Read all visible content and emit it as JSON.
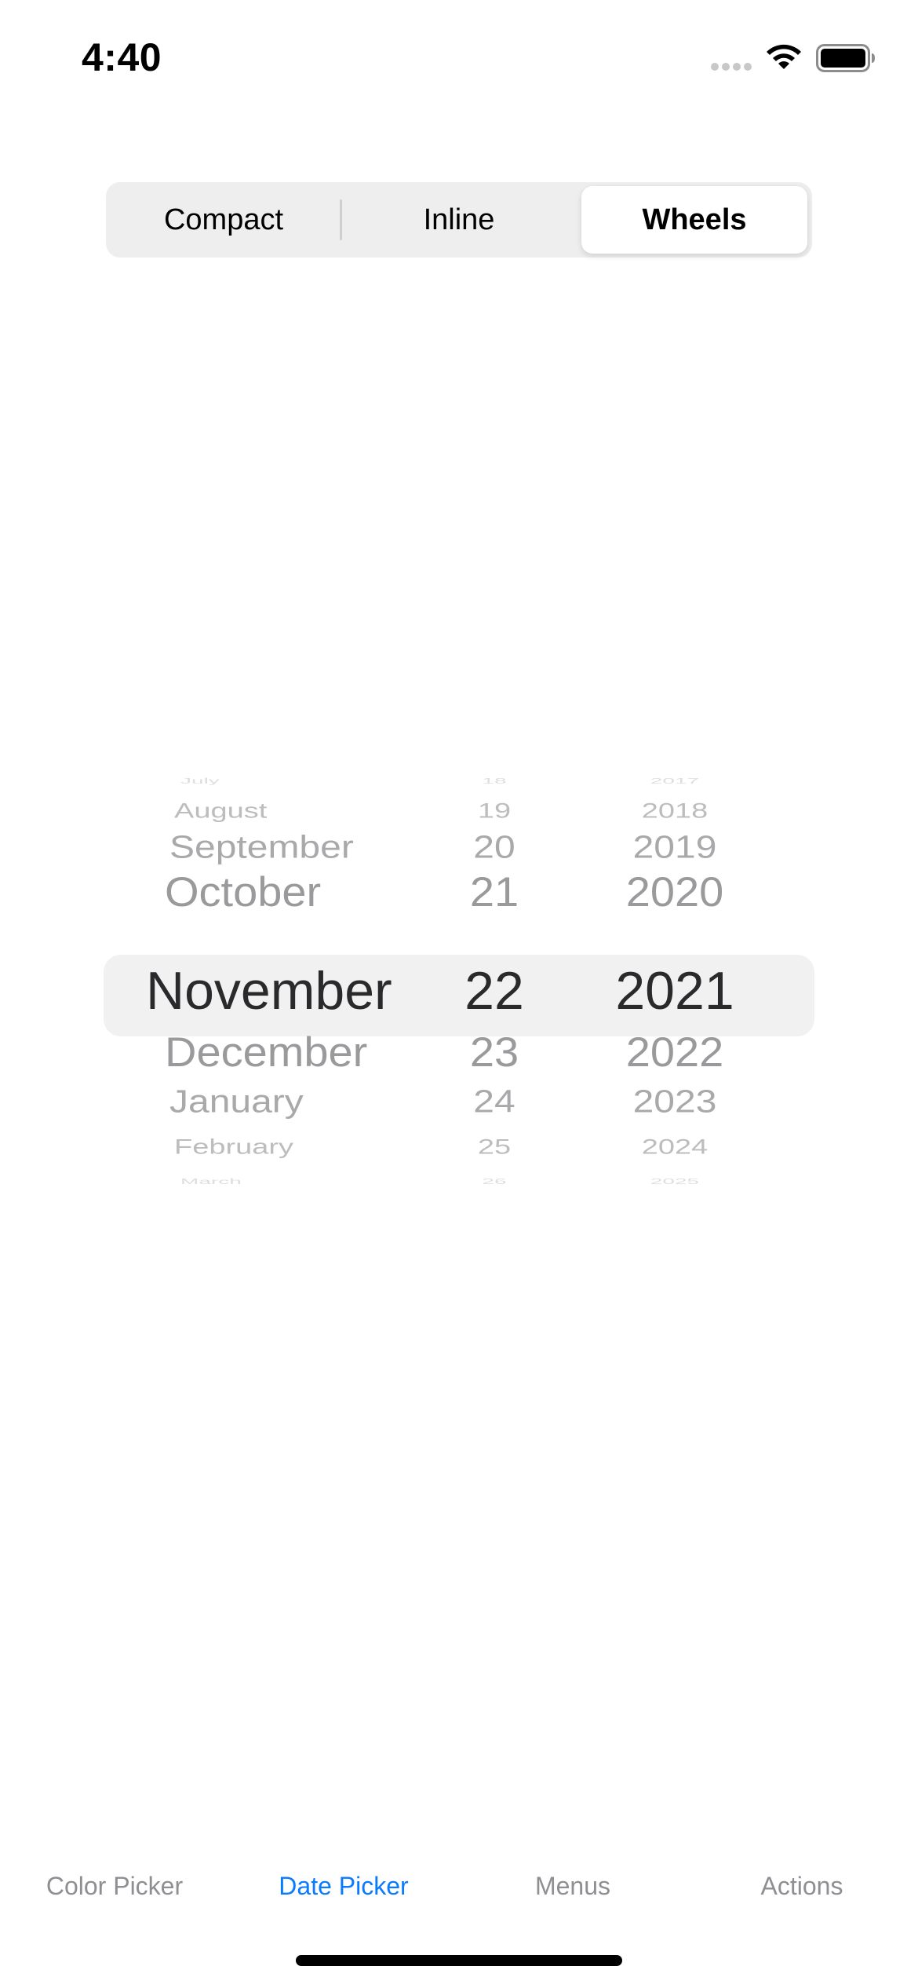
{
  "status_bar": {
    "time": "4:40",
    "icons": [
      "cellular-signal-icon",
      "wifi-icon",
      "battery-icon"
    ]
  },
  "segmented_control": {
    "segments": [
      "Compact",
      "Inline",
      "Wheels"
    ],
    "selected": "Wheels"
  },
  "date_picker": {
    "style": "wheels",
    "selected": {
      "month": "November",
      "day": "22",
      "year": "2021"
    },
    "months": [
      "July",
      "August",
      "September",
      "October",
      "November",
      "December",
      "January",
      "February",
      "March"
    ],
    "days": [
      "18",
      "19",
      "20",
      "21",
      "22",
      "23",
      "24",
      "25",
      "26"
    ],
    "years": [
      "2017",
      "2018",
      "2019",
      "2020",
      "2021",
      "2022",
      "2023",
      "2024",
      "2025"
    ]
  },
  "tab_bar": {
    "tabs": [
      "Color Picker",
      "Date Picker",
      "Menus",
      "Actions"
    ],
    "active": "Date Picker",
    "active_color": "#0a7aff",
    "inactive_color": "#8e8e93"
  }
}
